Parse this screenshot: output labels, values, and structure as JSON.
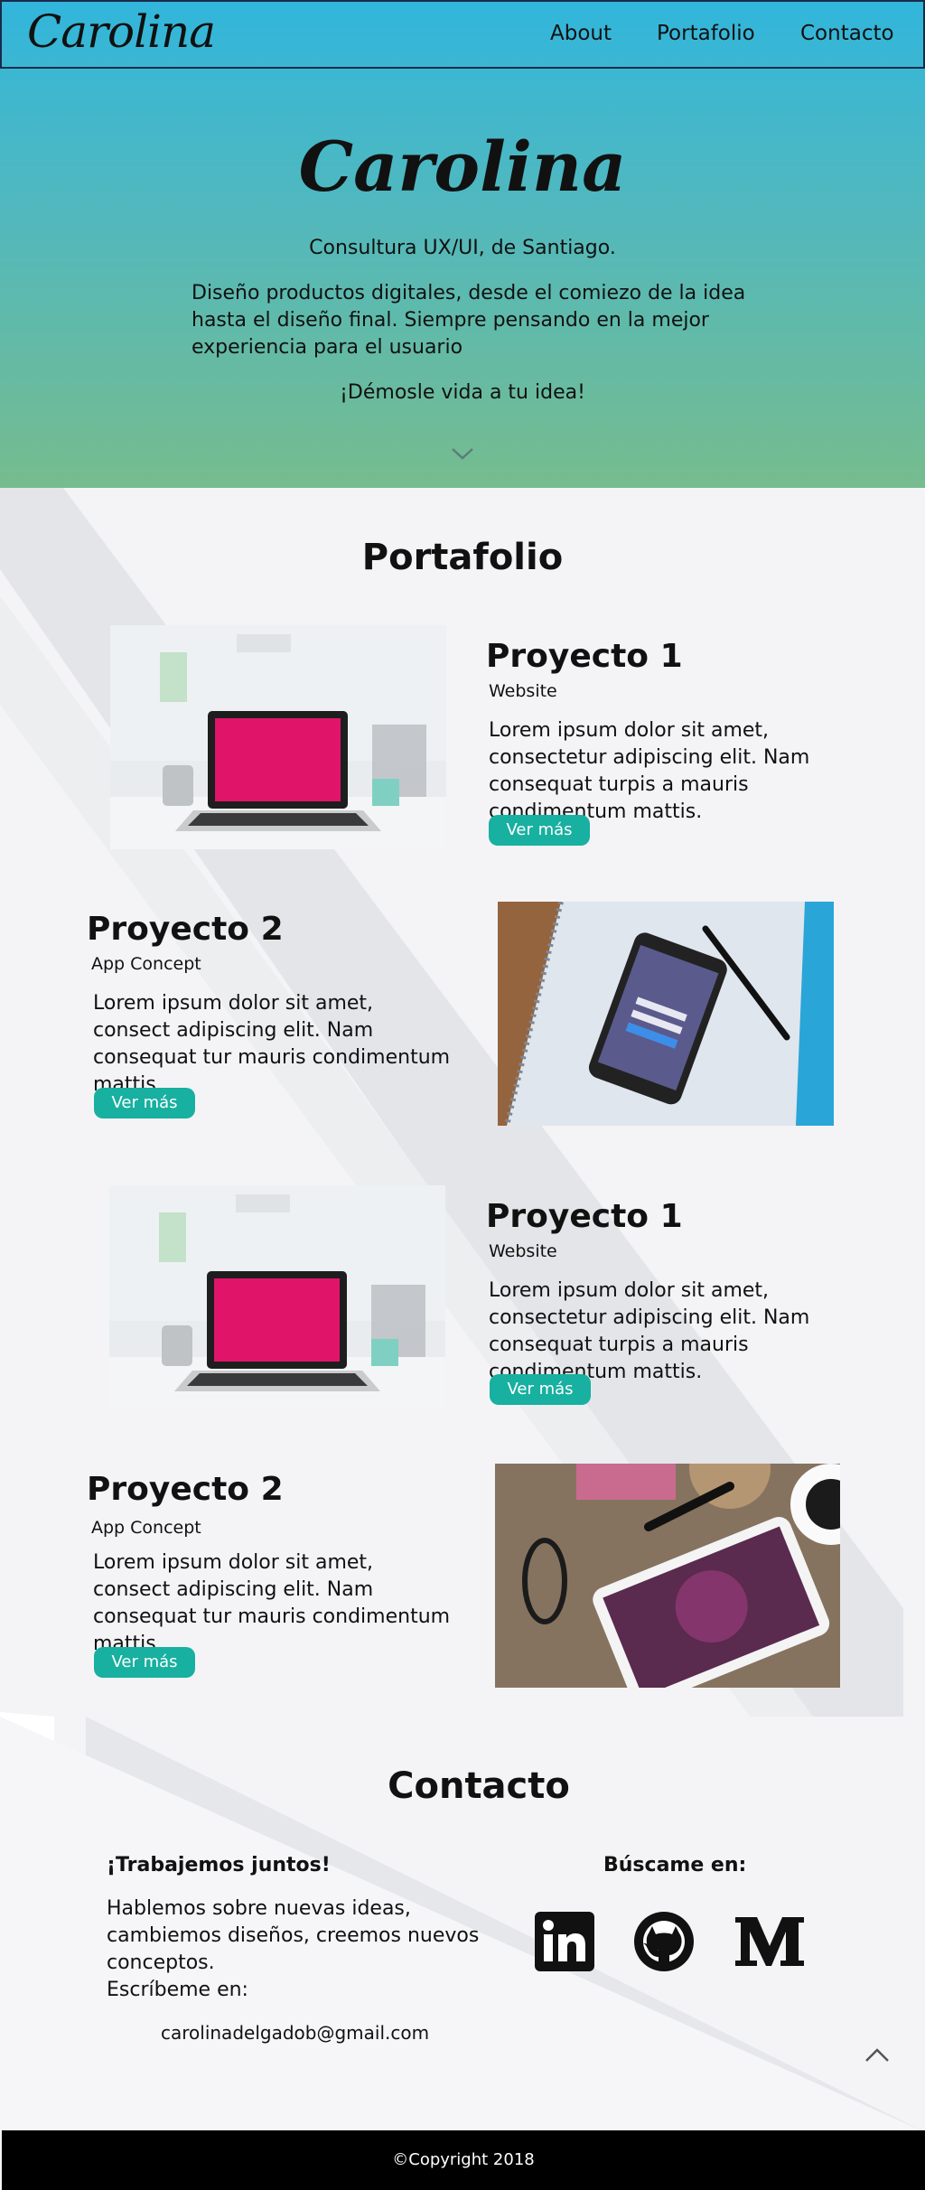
{
  "nav": {
    "logo": "Carolina",
    "links": [
      "About",
      "Portafolio",
      "Contacto"
    ]
  },
  "hero": {
    "title": "Carolina",
    "subtitle": "Consultura UX/UI, de Santiago.",
    "description": "Diseño productos digitales, desde el comiezo de la idea hasta el diseño final. Siempre pensando en la mejor experiencia para el usuario",
    "cta": "¡Démosle vida a tu idea!"
  },
  "portfolio": {
    "title": "Portafolio",
    "projects": [
      {
        "title": "Proyecto 1",
        "type": "Website",
        "desc": "Lorem ipsum dolor sit amet, consectetur adipiscing elit. Nam consequat turpis a mauris condimentum mattis.",
        "button": "Ver más"
      },
      {
        "title": "Proyecto 2",
        "type": "App Concept",
        "desc": "Lorem ipsum dolor sit amet, consect adipiscing elit. Nam consequat tur mauris condimentum mattis.",
        "button": "Ver más"
      },
      {
        "title": "Proyecto 1",
        "type": "Website",
        "desc": "Lorem ipsum dolor sit amet, consectetur adipiscing elit. Nam consequat turpis a mauris condimentum mattis.",
        "button": "Ver más"
      },
      {
        "title": "Proyecto 2",
        "type": "App Concept",
        "desc": "Lorem ipsum dolor sit amet, consect adipiscing elit. Nam consequat tur mauris condimentum mattis.",
        "button": "Ver más"
      }
    ]
  },
  "contact": {
    "title": "Contacto",
    "heading": "¡Trabajemos juntos!",
    "text": "Hablemos sobre nuevas ideas, cambiemos diseños, creemos nuevos conceptos.",
    "write": "Escríbeme en:",
    "email": "carolinadelgadob@gmail.com",
    "find": "Búscame en:",
    "social": [
      "linkedin-icon",
      "github-icon",
      "medium-icon"
    ]
  },
  "footer": {
    "copyright": "©Copyright 2018"
  },
  "colors": {
    "accent": "#18b0a0",
    "hero_top": "#31b6dc",
    "hero_bottom": "#76bc8e"
  }
}
